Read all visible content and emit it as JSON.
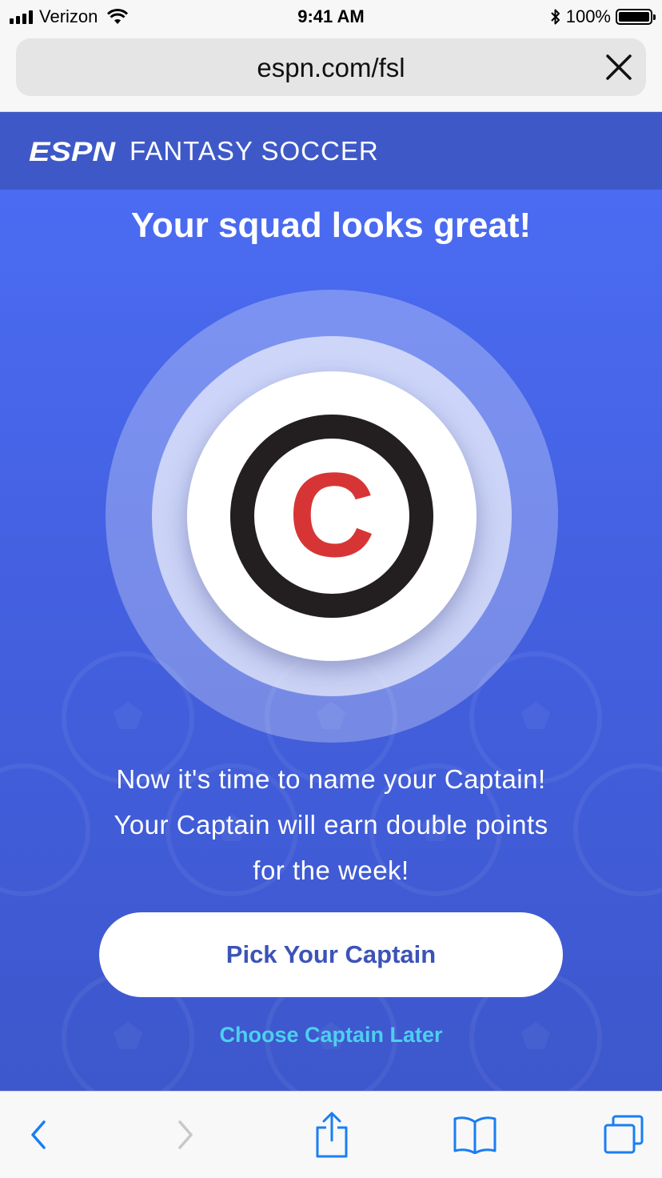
{
  "status_bar": {
    "carrier": "Verizon",
    "time": "9:41 AM",
    "battery_percent": "100%"
  },
  "browser": {
    "url": "espn.com/fsl",
    "icons": {
      "close": "close-icon",
      "back": "chevron-left-icon",
      "forward": "chevron-right-icon",
      "share": "share-icon",
      "bookmarks": "book-icon",
      "tabs": "tabs-icon"
    }
  },
  "header": {
    "logo": "ESPN",
    "product": "FANTASY SOCCER"
  },
  "main": {
    "headline": "Your squad looks great!",
    "captain_letter": "C",
    "message_lines": [
      "Now it's time to name your Captain!",
      "Your Captain will earn double points",
      "for the week!"
    ],
    "primary_button": "Pick Your Captain",
    "secondary_link": "Choose Captain Later"
  },
  "colors": {
    "header_bg": "#3e59c7",
    "content_bg": "#4461e2",
    "captain_red": "#d73535",
    "captain_ring": "#231f20",
    "button_text": "#3c53b7",
    "link": "#4cd0ee",
    "toolbar_active": "#1a7ef2",
    "toolbar_disabled": "#c7c7cc"
  }
}
